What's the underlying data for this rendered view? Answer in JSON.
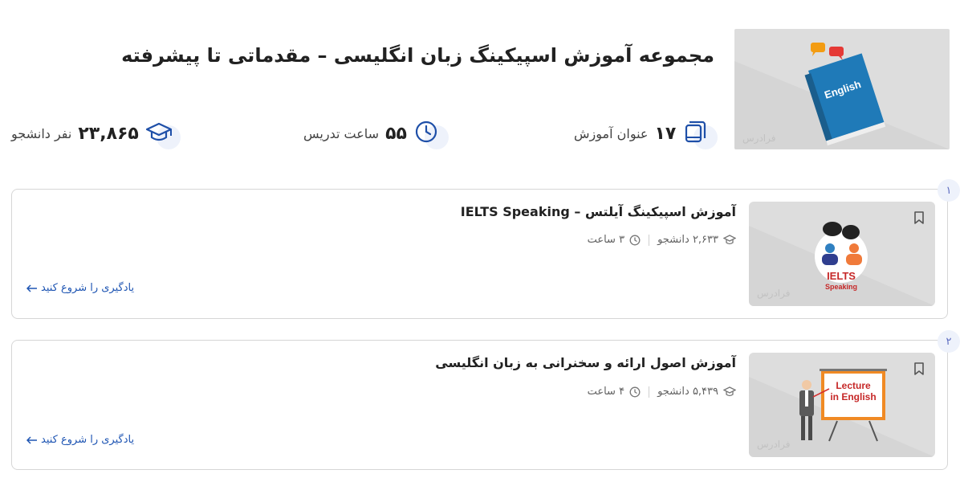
{
  "page": {
    "title": "مجموعه آموزش اسپیکینگ زبان انگلیسی – مقدماتی تا پیشرفته",
    "hero_book_text": "English",
    "watermark": "فرادرس"
  },
  "stats": {
    "titles": {
      "value": "۱۷",
      "label": "عنوان آموزش",
      "icon": "book-stack-icon"
    },
    "hours": {
      "value": "۵۵",
      "label": "ساعت تدریس",
      "icon": "clock-icon"
    },
    "students": {
      "value": "۲۳,۸۶۵",
      "label": "نفر دانشجو",
      "icon": "graduation-cap-icon"
    }
  },
  "courses": [
    {
      "index": "۱",
      "title": "آموزش اسپیکینگ آیلتس – IELTS Speaking",
      "students": "۲,۶۳۳ دانشجو",
      "duration": "۳ ساعت",
      "cta": "یادگیری را شروع کنید",
      "thumb_text_1": "IELTS",
      "thumb_text_2": "Speaking"
    },
    {
      "index": "۲",
      "title": "آموزش اصول ارائه و سخنرانی به زبان انگلیسی",
      "students": "۵,۴۳۹ دانشجو",
      "duration": "۴ ساعت",
      "cta": "یادگیری را شروع کنید",
      "thumb_text_1": "Lecture",
      "thumb_text_2": "in English"
    }
  ],
  "colors": {
    "accent": "#1e55b3",
    "icon": "#1e4fa8",
    "badge_bg": "#eef2fb"
  }
}
